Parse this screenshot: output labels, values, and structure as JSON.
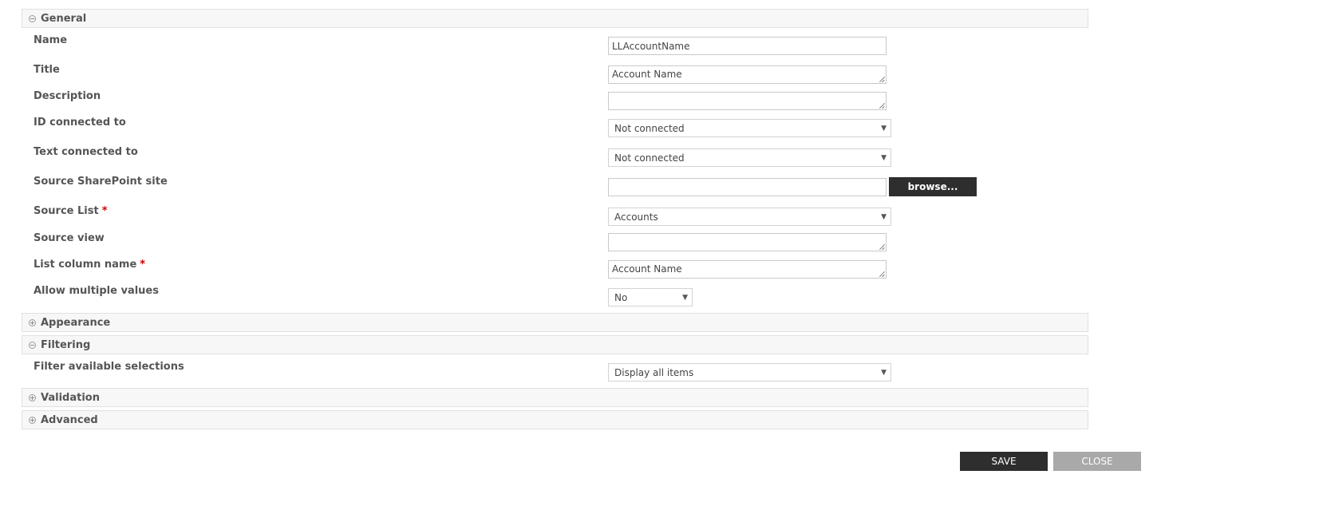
{
  "sections": {
    "general": {
      "title": "General",
      "state": "expanded"
    },
    "appearance": {
      "title": "Appearance",
      "state": "collapsed"
    },
    "filtering": {
      "title": "Filtering",
      "state": "expanded"
    },
    "validation": {
      "title": "Validation",
      "state": "collapsed"
    },
    "advanced": {
      "title": "Advanced",
      "state": "collapsed"
    }
  },
  "fields": {
    "name": {
      "label": "Name",
      "value": "LLAccountName"
    },
    "title": {
      "label": "Title",
      "value": "Account Name"
    },
    "description": {
      "label": "Description",
      "value": ""
    },
    "id_connected": {
      "label": "ID connected to",
      "value": "Not connected"
    },
    "text_connected": {
      "label": "Text connected to",
      "value": "Not connected"
    },
    "source_site": {
      "label": "Source SharePoint site",
      "value": "",
      "browse_label": "browse..."
    },
    "source_list": {
      "label": "Source List",
      "required_mark": "*",
      "value": "Accounts"
    },
    "source_view": {
      "label": "Source view",
      "value": ""
    },
    "list_column": {
      "label": "List column name",
      "required_mark": "*",
      "value": "Account Name"
    },
    "allow_multiple": {
      "label": "Allow multiple values",
      "value": "No"
    },
    "filter_selections": {
      "label": "Filter available selections",
      "value": "Display all items"
    }
  },
  "footer": {
    "save_label": "SAVE",
    "close_label": "CLOSE"
  },
  "colors": {
    "dark_button": "#2e2e2e",
    "disabled_button": "#a9a9a9",
    "required": "#cc0000",
    "header_bg": "#f7f7f7"
  },
  "icons": {
    "collapse": "minus-circle-icon",
    "expand": "plus-circle-icon",
    "dropdown": "caret-down-icon"
  }
}
